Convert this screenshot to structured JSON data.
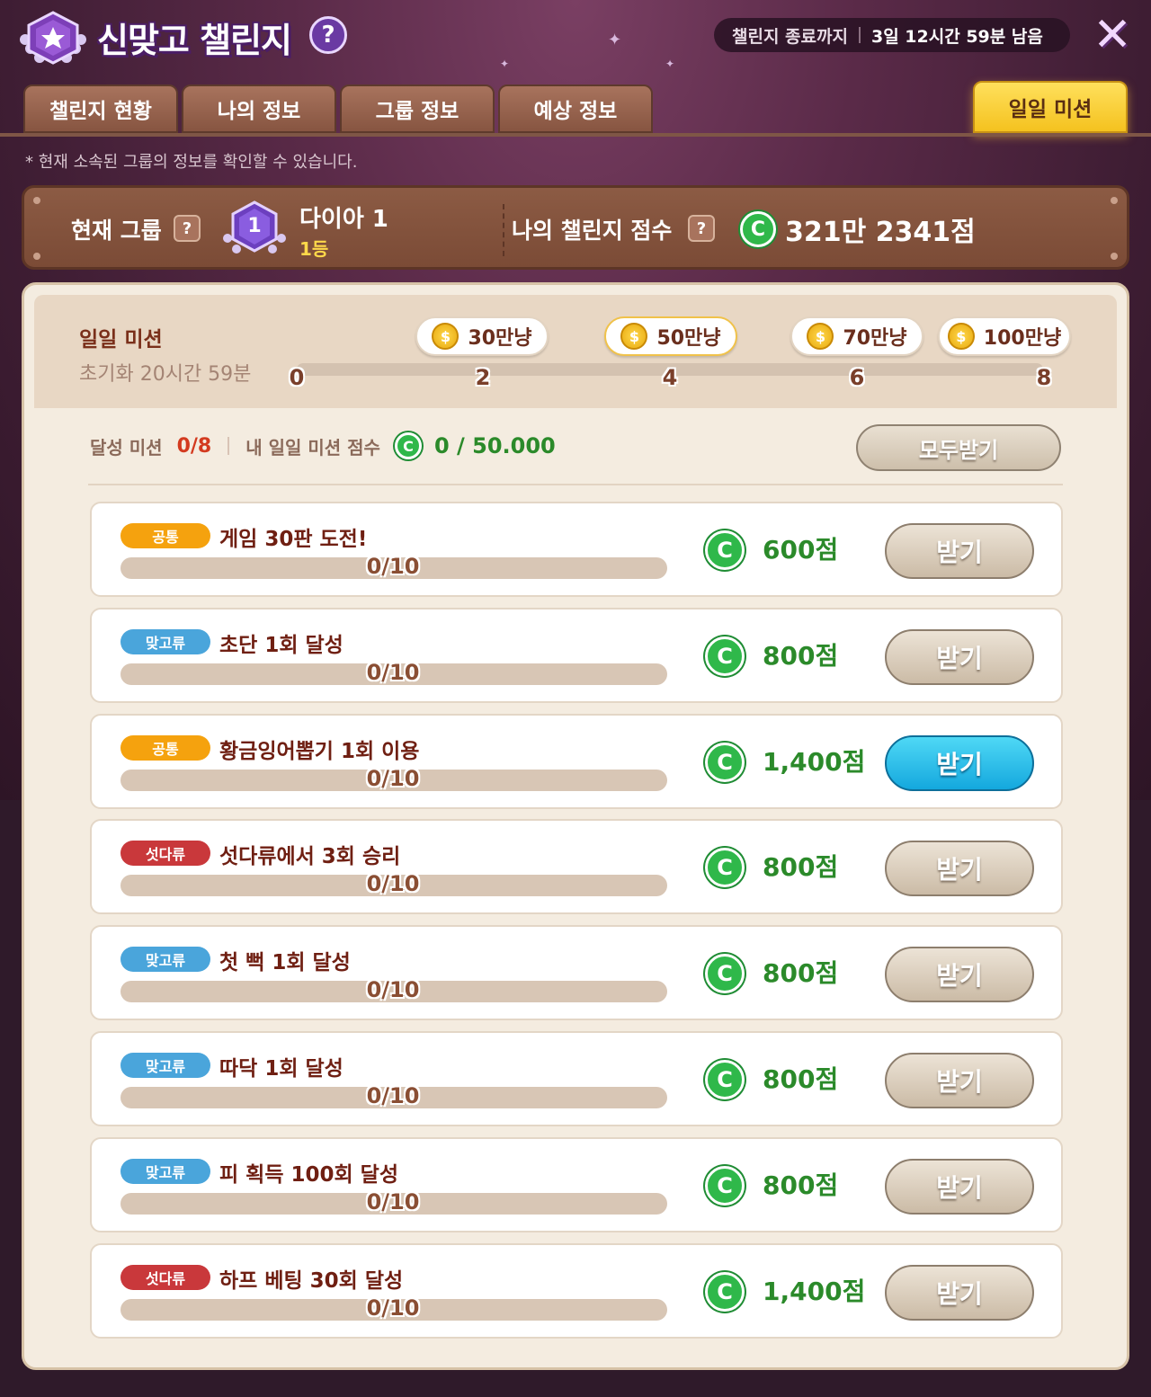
{
  "header": {
    "title": "신맞고 챌린지",
    "help": "?",
    "timer_label": "챌린지 종료까지",
    "timer_value": "3일 12시간 59분 남음",
    "close": "✕"
  },
  "tabs": [
    "챌린지 현황",
    "나의 정보",
    "그룹 정보",
    "예상 정보"
  ],
  "active_tab": "일일 미션",
  "notice": "* 현재 소속된 그룹의 정보를 확인할 수 있습니다.",
  "group": {
    "label": "현재 그룹",
    "help": "?",
    "tier_num": "1",
    "tier_name": "다이아 1",
    "rank": "1등",
    "score_label": "나의 챌린지 점수",
    "score_help": "?",
    "score": "321만 2341점"
  },
  "daily": {
    "title": "일일 미션",
    "reset": "초기화 20시간 59분",
    "ticks": [
      "0",
      "2",
      "4",
      "6",
      "8"
    ],
    "rewards": [
      "30만냥",
      "50만냥",
      "70만냥",
      "100만냥"
    ],
    "coin_symbol": "$"
  },
  "summary": {
    "achieved_label": "달성 미션",
    "achieved_value": "0/8",
    "score_label": "내 일일 미션 점수",
    "score_value": "0 / 50.000",
    "get_all": "모두받기"
  },
  "c_symbol": "C",
  "missions": [
    {
      "tag": "공통",
      "tag_color": "#f5a20e",
      "title": "게임 30판 도전!",
      "progress": "0/10",
      "points": "600점",
      "button": "받기",
      "active": false
    },
    {
      "tag": "맞고류",
      "tag_color": "#4aa5db",
      "title": "초단 1회 달성",
      "progress": "0/10",
      "points": "800점",
      "button": "받기",
      "active": false
    },
    {
      "tag": "공통",
      "tag_color": "#f5a20e",
      "title": "황금잉어뽑기 1회 이용",
      "progress": "0/10",
      "points": "1,400점",
      "button": "받기",
      "active": true
    },
    {
      "tag": "섯다류",
      "tag_color": "#c9383b",
      "title": "섯다류에서 3회 승리",
      "progress": "0/10",
      "points": "800점",
      "button": "받기",
      "active": false
    },
    {
      "tag": "맞고류",
      "tag_color": "#4aa5db",
      "title": "첫 뻑 1회 달성",
      "progress": "0/10",
      "points": "800점",
      "button": "받기",
      "active": false
    },
    {
      "tag": "맞고류",
      "tag_color": "#4aa5db",
      "title": "따닥 1회 달성",
      "progress": "0/10",
      "points": "800점",
      "button": "받기",
      "active": false
    },
    {
      "tag": "맞고류",
      "tag_color": "#4aa5db",
      "title": "피 획득 100회 달성",
      "progress": "0/10",
      "points": "800점",
      "button": "받기",
      "active": false
    },
    {
      "tag": "섯다류",
      "tag_color": "#c9383b",
      "title": "하프 베팅 30회 달성",
      "progress": "0/10",
      "points": "1,400점",
      "button": "받기",
      "active": false
    }
  ]
}
